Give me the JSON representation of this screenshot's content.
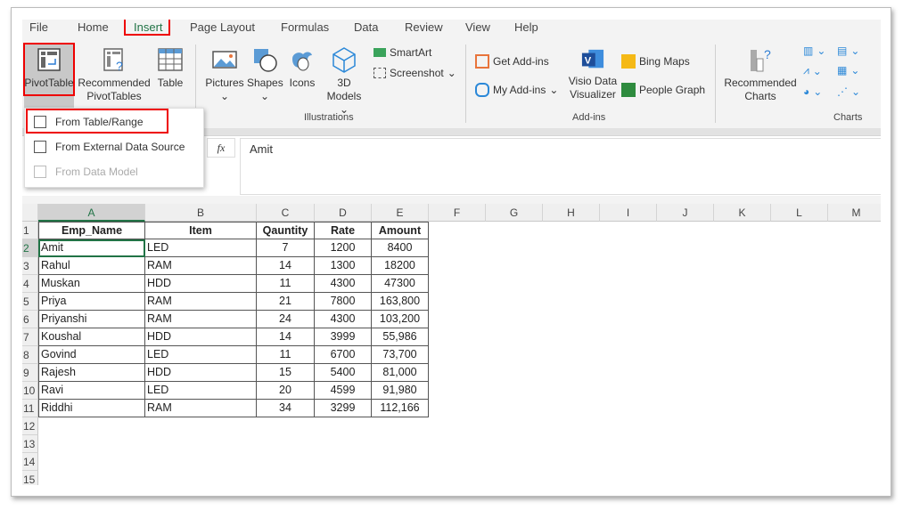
{
  "tabs": [
    "File",
    "Home",
    "Insert",
    "Page Layout",
    "Formulas",
    "Data",
    "Review",
    "View",
    "Help"
  ],
  "active_tab": "Insert",
  "ribbon": {
    "pivottable": "PivotTable",
    "recommended_pivot": [
      "Recommended",
      "PivotTables"
    ],
    "table": "Table",
    "pictures": "Pictures",
    "shapes": "Shapes",
    "icons": "Icons",
    "models": [
      "3D",
      "Models"
    ],
    "smartart": "SmartArt",
    "screenshot": "Screenshot",
    "illustrations_group": "Illustrations",
    "get_addins": "Get Add-ins",
    "my_addins": "My Add-ins",
    "visio": [
      "Visio Data",
      "Visualizer"
    ],
    "bing_maps": "Bing Maps",
    "people_graph": "People Graph",
    "addins_group": "Add-ins",
    "recommended_charts": [
      "Recommended",
      "Charts"
    ],
    "charts_group": "Charts"
  },
  "pivot_menu": {
    "items": [
      {
        "label": "From Table/Range",
        "enabled": true
      },
      {
        "label": "From External Data Source",
        "enabled": true
      },
      {
        "label": "From Data Model",
        "enabled": false
      }
    ]
  },
  "formula_bar": {
    "fx": "fx",
    "value": "Amit"
  },
  "sheet": {
    "columns": [
      "A",
      "B",
      "C",
      "D",
      "E",
      "F",
      "G",
      "H",
      "I",
      "J",
      "K",
      "L",
      "M"
    ],
    "rows": [
      "1",
      "2",
      "3",
      "4",
      "5",
      "6",
      "7",
      "8",
      "9",
      "10",
      "11",
      "12",
      "13",
      "14",
      "15"
    ],
    "header": [
      "Emp_Name",
      "Item",
      "Qauntity",
      "Rate",
      "Amount"
    ],
    "data": [
      [
        "Amit",
        "LED",
        "7",
        "1200",
        "8400"
      ],
      [
        "Rahul",
        "RAM",
        "14",
        "1300",
        "18200"
      ],
      [
        "Muskan",
        "HDD",
        "11",
        "4300",
        "47300"
      ],
      [
        "Priya",
        "RAM",
        "21",
        "7800",
        "163,800"
      ],
      [
        "Priyanshi",
        "RAM",
        "24",
        "4300",
        "103,200"
      ],
      [
        "Koushal",
        "HDD",
        "14",
        "3999",
        "55,986"
      ],
      [
        "Govind",
        "LED",
        "11",
        "6700",
        "73,700"
      ],
      [
        "Rajesh",
        "HDD",
        "15",
        "5400",
        "81,000"
      ],
      [
        "Ravi",
        "LED",
        "20",
        "4599",
        "91,980"
      ],
      [
        "Riddhi",
        "RAM",
        "34",
        "3299",
        "112,166"
      ]
    ],
    "selected_cell": "A2"
  },
  "colors": {
    "highlight": "#e00000",
    "excel_green": "#217346"
  }
}
